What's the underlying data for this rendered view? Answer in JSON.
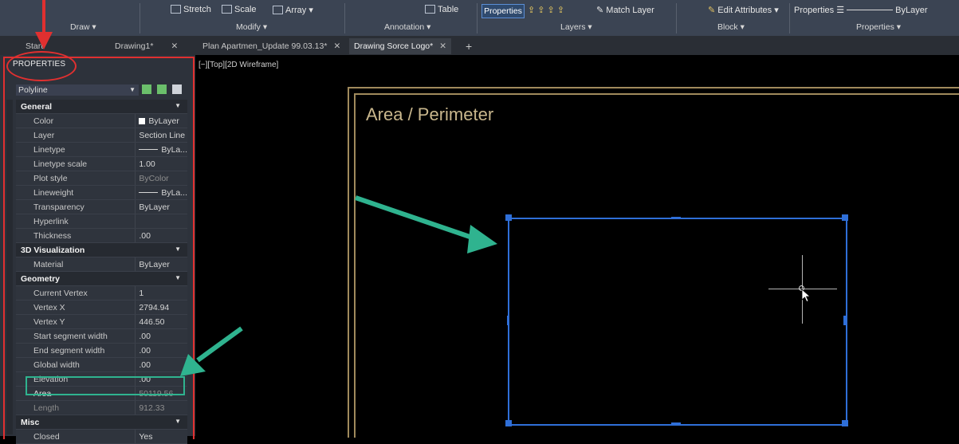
{
  "ribbon": {
    "draw_panel": "Draw",
    "modify_panel": "Modify",
    "annotation_panel": "Annotation",
    "layers_panel": "Layers",
    "block_panel": "Block",
    "properties_panel": "Properties",
    "stretch": "Stretch",
    "scale": "Scale",
    "array": "Array",
    "table": "Table",
    "properties_btn": "Properties",
    "match_layer": "Match Layer",
    "edit_attributes": "Edit Attributes",
    "properties_right": "Properties",
    "bylayer": "ByLayer"
  },
  "tabs": [
    {
      "label": "Start"
    },
    {
      "label": "Drawing1*"
    },
    {
      "label": "Plan Apartmen_Update 99.03.13*"
    },
    {
      "label": "Drawing Sorce Logo*"
    }
  ],
  "viewport": {
    "label": "[−][Top][2D Wireframe]",
    "frame_title": "Area / Perimeter"
  },
  "properties": {
    "header": "PROPERTIES",
    "object_type": "Polyline",
    "general": {
      "title": "General",
      "rows": [
        {
          "name": "Color",
          "value": "ByLayer"
        },
        {
          "name": "Layer",
          "value": "Section Line"
        },
        {
          "name": "Linetype",
          "value": "ByLa..."
        },
        {
          "name": "Linetype scale",
          "value": "1.00"
        },
        {
          "name": "Plot style",
          "value": "ByColor"
        },
        {
          "name": "Lineweight",
          "value": "ByLa..."
        },
        {
          "name": "Transparency",
          "value": "ByLayer"
        },
        {
          "name": "Hyperlink",
          "value": ""
        },
        {
          "name": "Thickness",
          "value": ".00"
        }
      ]
    },
    "viz": {
      "title": "3D Visualization",
      "rows": [
        {
          "name": "Material",
          "value": "ByLayer"
        }
      ]
    },
    "geometry": {
      "title": "Geometry",
      "rows": [
        {
          "name": "Current Vertex",
          "value": "1"
        },
        {
          "name": "Vertex X",
          "value": "2794.94"
        },
        {
          "name": "Vertex Y",
          "value": "446.50"
        },
        {
          "name": "Start segment width",
          "value": ".00"
        },
        {
          "name": "End segment width",
          "value": ".00"
        },
        {
          "name": "Global width",
          "value": ".00"
        },
        {
          "name": "Elevation",
          "value": ".00"
        },
        {
          "name": "Area",
          "value": "50119.56"
        },
        {
          "name": "Length",
          "value": "912.33"
        }
      ]
    },
    "misc": {
      "title": "Misc",
      "rows": [
        {
          "name": "Closed",
          "value": "Yes"
        }
      ]
    }
  },
  "colors": {
    "annotation_red": "#e03030",
    "annotation_green": "#2fb38f",
    "polyline_blue": "#2f6fd8",
    "frame_gold": "#a08a5c"
  }
}
